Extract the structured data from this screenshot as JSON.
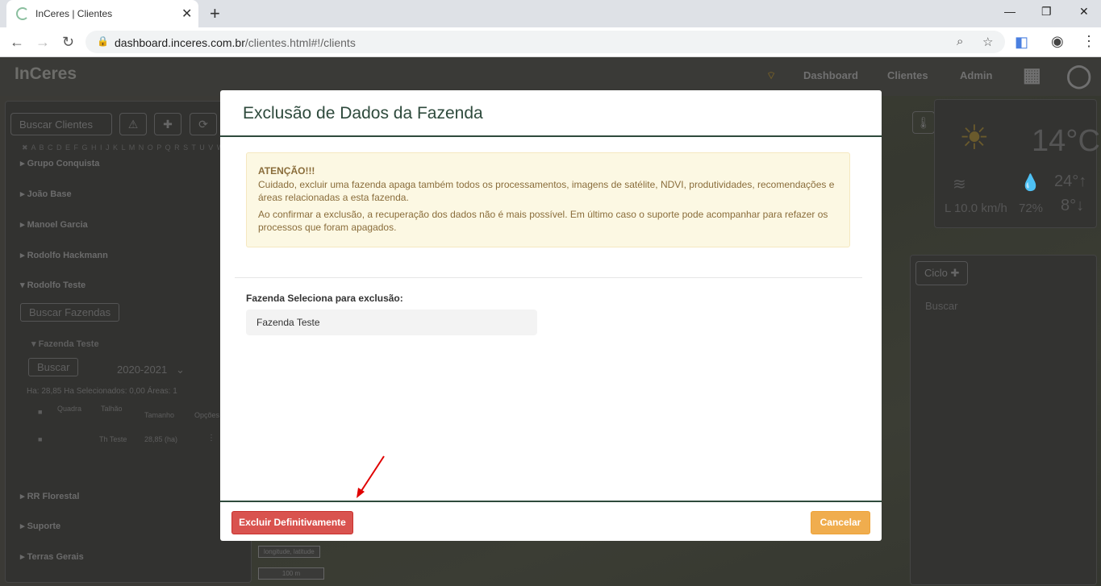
{
  "browser": {
    "tab_title": "InCeres | Clientes",
    "new_tab": "+",
    "url_domain": "dashboard.inceres.com.br",
    "url_path": "/clientes.html#!/clients"
  },
  "app": {
    "logo": "InCeres",
    "nav": {
      "dashboard": "Dashboard",
      "clients": "Clientes",
      "admin": "Admin"
    },
    "left_panel": {
      "search_placeholder": "Buscar Clientes",
      "alphabet": "✖ A B C D E F G H I J K L M N O P Q R S T U V W X",
      "groups": [
        "Grupo Conquista",
        "João Base",
        "Manoel Garcia",
        "Rodolfo Hackmann",
        "Rodolfo Teste",
        "RR Florestal",
        "Suporte",
        "Terras Gerais"
      ],
      "search_farms": "Buscar Fazendas",
      "farm_name": "Fazenda Teste",
      "search_btn": "Buscar",
      "season": "2020-2021",
      "stats": "Ha: 28,85    Ha Selecionados: 0,00    Áreas: 1",
      "table_headers": [
        "Quadra",
        "Talhão",
        "Tamanho",
        "Opções"
      ],
      "row": {
        "talhao": "Th Teste",
        "size": "28,85 (ha)"
      }
    },
    "weather": {
      "temp": "14°C",
      "wind": "L 10.0 km/h",
      "humidity": "72%",
      "max": "24°",
      "min": "8°"
    },
    "right_panel": {
      "ciclo": "Ciclo",
      "search": "Buscar"
    },
    "map": {
      "coords": "longitude, latitude",
      "scale": "100 m"
    }
  },
  "modal": {
    "title": "Exclusão de Dados da Fazenda",
    "alert_title": "ATENÇÃO!!!",
    "alert_p1": "Cuidado, excluir uma fazenda apaga também todos os processamentos, imagens de satélite, NDVI, produtividades, recomendações e áreas relacionadas a esta fazenda.",
    "alert_p2": "Ao confirmar a exclusão, a recuperação dos dados não é mais possível. Em último caso o suporte pode acompanhar para refazer os processos que foram apagados.",
    "field_label": "Fazenda Seleciona para exclusão:",
    "field_value": "Fazenda Teste",
    "delete_button": "Excluir Definitivamente",
    "cancel_button": "Cancelar"
  },
  "colors": {
    "danger": "#d9534f",
    "warning": "#f0ad4e",
    "brand": "#2e4a3c",
    "annotation_arrow": "#e00000"
  }
}
